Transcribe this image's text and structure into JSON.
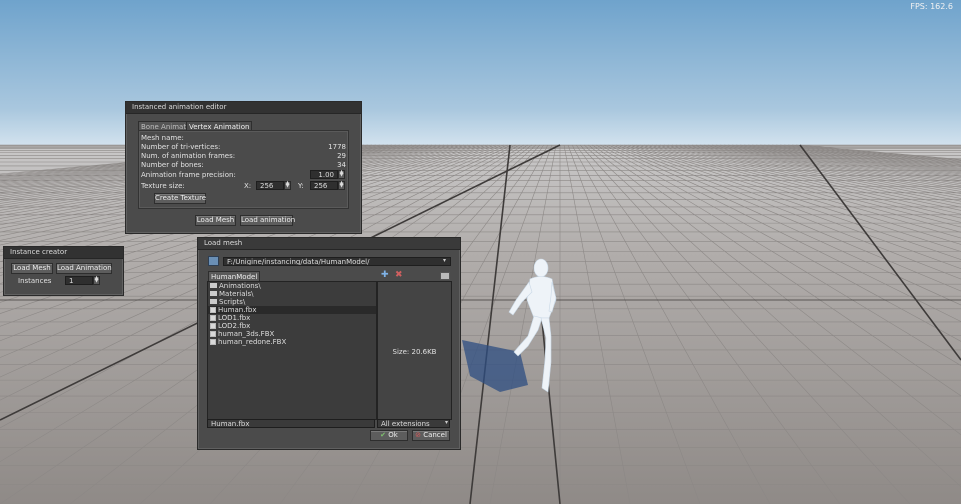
{
  "fps": "FPS: 162.6",
  "editor": {
    "title": "Instanced animation editor",
    "tabs": [
      "Bone Animation",
      "Vertex Animation"
    ],
    "rows": [
      {
        "label": "Mesh name:",
        "value": ""
      },
      {
        "label": "Number of tri-vertices:",
        "value": "1778"
      },
      {
        "label": "Num. of animation frames:",
        "value": "29"
      },
      {
        "label": "Number of bones:",
        "value": "34"
      }
    ],
    "precision_label": "Animation frame precision:",
    "precision_value": "1.00",
    "texture_label": "Texture size:",
    "x_label": "X:",
    "x_value": "256",
    "y_label": "Y:",
    "y_value": "256",
    "create_texture": "Create Texture",
    "load_mesh": "Load Mesh",
    "load_animation": "Load animation"
  },
  "creator": {
    "title": "Instance creator",
    "load_mesh": "Load Mesh",
    "load_animation": "Load Animation",
    "instances_label": "Instances",
    "instances_value": "1"
  },
  "loadmesh": {
    "title": "Load mesh",
    "path": "F:/Unigine/instancing/data/HumanModel/",
    "folder_tab": "HumanModel",
    "items": [
      {
        "name": "Animations\\",
        "type": "dir"
      },
      {
        "name": "Materials\\",
        "type": "dir"
      },
      {
        "name": "Scripts\\",
        "type": "dir"
      },
      {
        "name": "Human.fbx",
        "type": "file",
        "selected": true
      },
      {
        "name": "LOD1.fbx",
        "type": "file"
      },
      {
        "name": "LOD2.fbx",
        "type": "file"
      },
      {
        "name": "human_3ds.FBX",
        "type": "file"
      },
      {
        "name": "human_redone.FBX",
        "type": "file"
      }
    ],
    "size_text": "Size: 20.6KB",
    "filename": "Human.fbx",
    "extension": "All extensions",
    "ok": "Ok",
    "cancel": "Cancel"
  },
  "colors": {
    "sky_top": "#6fa3cc",
    "sky_horizon": "#c8dbe9",
    "floor": "#a39f9c",
    "panel": "#4b4b4b",
    "title_bar": "#323232"
  }
}
